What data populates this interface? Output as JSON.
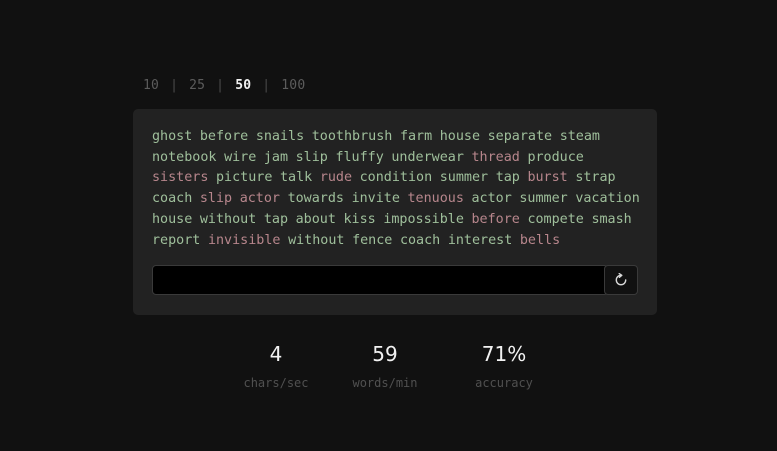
{
  "word_counts": {
    "options": [
      "10",
      "25",
      "50",
      "100"
    ],
    "separator": "|",
    "selected": "50"
  },
  "passage": {
    "words": [
      {
        "text": "ghost",
        "correct": true
      },
      {
        "text": "before",
        "correct": true
      },
      {
        "text": "snails",
        "correct": true
      },
      {
        "text": "toothbrush",
        "correct": true
      },
      {
        "text": "farm",
        "correct": true
      },
      {
        "text": "house",
        "correct": true
      },
      {
        "text": "separate",
        "correct": true
      },
      {
        "text": "steam",
        "correct": true
      },
      {
        "text": "notebook",
        "correct": true
      },
      {
        "text": "wire",
        "correct": true
      },
      {
        "text": "jam",
        "correct": true
      },
      {
        "text": "slip",
        "correct": true
      },
      {
        "text": "fluffy",
        "correct": true
      },
      {
        "text": "underwear",
        "correct": true
      },
      {
        "text": "thread",
        "correct": false
      },
      {
        "text": "produce",
        "correct": true
      },
      {
        "text": "sisters",
        "correct": false
      },
      {
        "text": "picture",
        "correct": true
      },
      {
        "text": "talk",
        "correct": true
      },
      {
        "text": "rude",
        "correct": false
      },
      {
        "text": "condition",
        "correct": true
      },
      {
        "text": "summer",
        "correct": true
      },
      {
        "text": "tap",
        "correct": true
      },
      {
        "text": "burst",
        "correct": false
      },
      {
        "text": "strap",
        "correct": true
      },
      {
        "text": "coach",
        "correct": true
      },
      {
        "text": "slip",
        "correct": false
      },
      {
        "text": "actor",
        "correct": false
      },
      {
        "text": "towards",
        "correct": true
      },
      {
        "text": "invite",
        "correct": true
      },
      {
        "text": "tenuous",
        "correct": false
      },
      {
        "text": "actor",
        "correct": true
      },
      {
        "text": "summer",
        "correct": true
      },
      {
        "text": "vacation",
        "correct": true
      },
      {
        "text": "house",
        "correct": true
      },
      {
        "text": "without",
        "correct": true
      },
      {
        "text": "tap",
        "correct": true
      },
      {
        "text": "about",
        "correct": true
      },
      {
        "text": "kiss",
        "correct": true
      },
      {
        "text": "impossible",
        "correct": true
      },
      {
        "text": "before",
        "correct": false
      },
      {
        "text": "compete",
        "correct": true
      },
      {
        "text": "smash",
        "correct": true
      },
      {
        "text": "report",
        "correct": true
      },
      {
        "text": "invisible",
        "correct": false
      },
      {
        "text": "without",
        "correct": true
      },
      {
        "text": "fence",
        "correct": true
      },
      {
        "text": "coach",
        "correct": true
      },
      {
        "text": "interest",
        "correct": true
      },
      {
        "text": "bells",
        "correct": false
      }
    ]
  },
  "input": {
    "value": "",
    "placeholder": ""
  },
  "reset": {
    "icon": "reset-icon"
  },
  "stats": {
    "cps": {
      "value": "4",
      "label": "chars/sec"
    },
    "wpm": {
      "value": "59",
      "label": "words/min"
    },
    "accuracy": {
      "value": "71%",
      "label": "accuracy"
    }
  },
  "colors": {
    "background": "#111111",
    "panel": "#222222",
    "word_correct": "#9fbf9b",
    "word_incorrect": "#b7868c",
    "selected_option": "#f2f2f2",
    "muted": "#5c5c5c"
  }
}
